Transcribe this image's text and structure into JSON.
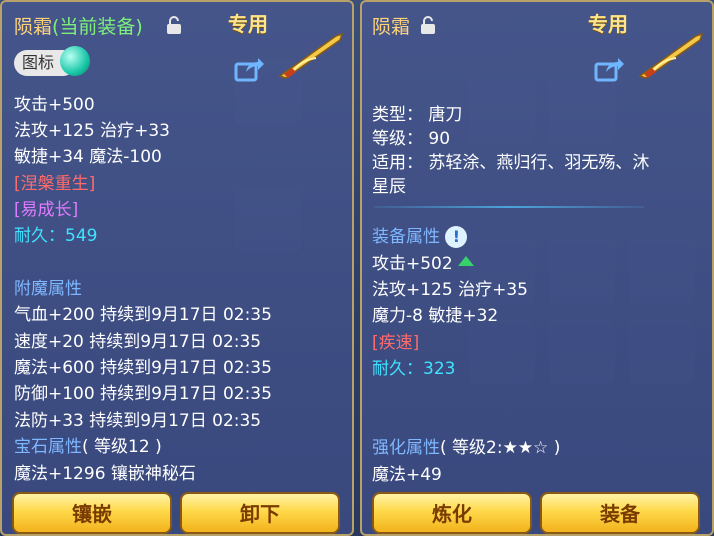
{
  "left": {
    "title": "陨霜",
    "title_suffix": "(当前装备)",
    "zhuanyong": "专用",
    "icon_tag": "图标",
    "stats": [
      "攻击+500",
      "法攻+125 治疗+33",
      "敏捷+34 魔法-100"
    ],
    "tag1": "[涅槃重生]",
    "tag2": "[易成长]",
    "durability_label": "耐久：",
    "durability_value": "549",
    "enchant_title": "附魔属性",
    "enchants": [
      "气血+200 持续到9月17日 02:35",
      "速度+20 持续到9月17日 02:35",
      "魔法+600 持续到9月17日 02:35",
      "防御+100 持续到9月17日 02:35",
      "法防+33 持续到9月17日 02:35"
    ],
    "gem_title": "宝石属性",
    "gem_level": "( 等级12 )",
    "gem_line": "魔法+1296 镶嵌神秘石",
    "btn_inlay": "镶嵌",
    "btn_unequip": "卸下"
  },
  "right": {
    "title": "陨霜",
    "zhuanyong": "专用",
    "type": "类型：  唐刀",
    "level": "等级：  90",
    "fit1": "适用：  苏轻涂、燕归行、羽无殇、沐",
    "fit2": "星辰",
    "equip_title": "装备属性",
    "stats": [
      "攻击+502",
      "法攻+125 治疗+35",
      "魔力-8 敏捷+32"
    ],
    "tag1": "[疾速]",
    "durability_label": "耐久：",
    "durability_value": "323",
    "enhance_title": "强化属性",
    "enhance_level": "( 等级2:★★☆ )",
    "enhance_line": "魔法+49",
    "btn_refine": "炼化",
    "btn_equip": "装备"
  }
}
